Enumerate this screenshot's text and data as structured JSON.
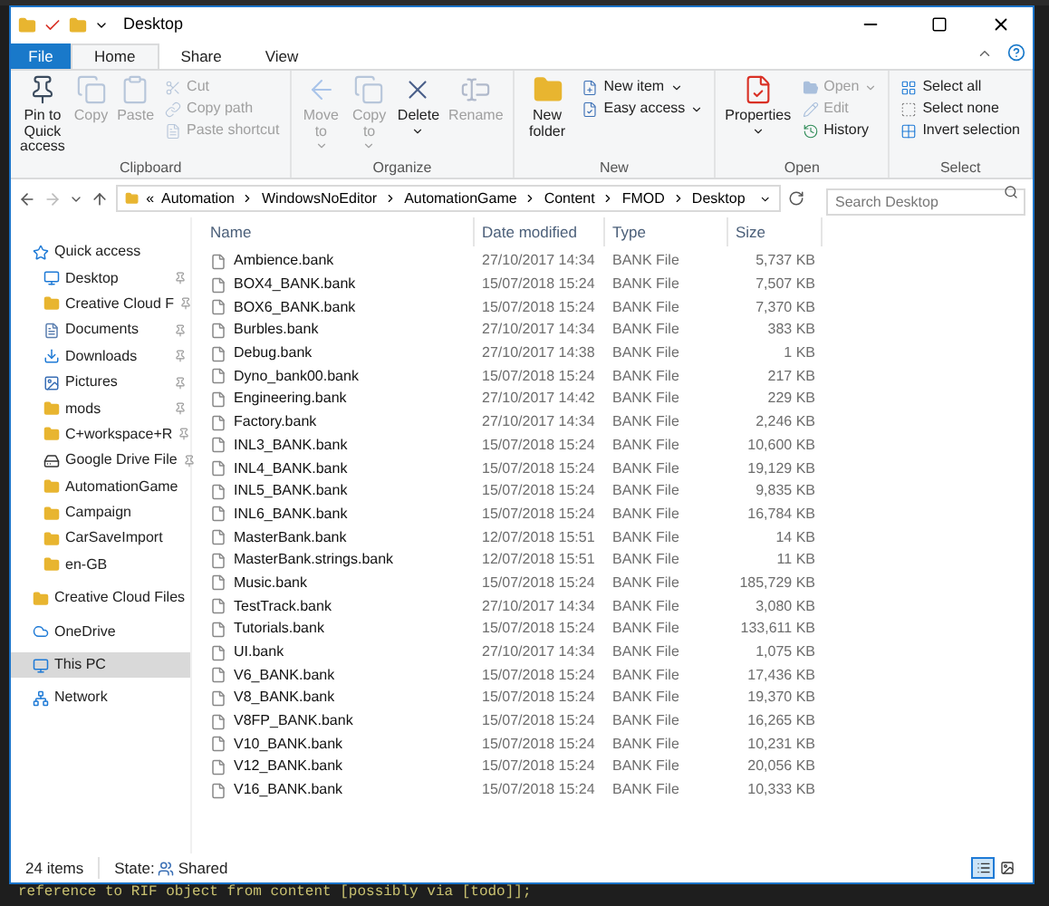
{
  "window": {
    "title": "Desktop"
  },
  "ribbon_tabs": [
    {
      "label": "File",
      "kind": "file",
      "selected": false
    },
    {
      "label": "Home",
      "kind": "tab",
      "selected": true
    },
    {
      "label": "Share",
      "kind": "tab",
      "selected": false
    },
    {
      "label": "View",
      "kind": "tab",
      "selected": false
    }
  ],
  "ribbon_groups": [
    {
      "label": "Clipboard",
      "buttons": [
        {
          "label": "Pin to Quick access",
          "kind": "large",
          "disabled": false
        },
        {
          "label": "Copy",
          "kind": "large",
          "disabled": true
        },
        {
          "label": "Paste",
          "kind": "large",
          "disabled": true
        },
        {
          "kind": "stack",
          "items": [
            {
              "label": "Cut",
              "disabled": true
            },
            {
              "label": "Copy path",
              "disabled": true
            },
            {
              "label": "Paste shortcut",
              "disabled": true
            }
          ]
        }
      ]
    },
    {
      "label": "Organize",
      "buttons": [
        {
          "label": "Move to",
          "kind": "large",
          "disabled": true,
          "dropdown": true
        },
        {
          "label": "Copy to",
          "kind": "large",
          "disabled": true,
          "dropdown": true
        },
        {
          "label": "Delete",
          "kind": "large",
          "disabled": false,
          "dropdown": true
        },
        {
          "label": "Rename",
          "kind": "large",
          "disabled": true
        }
      ]
    },
    {
      "label": "New",
      "buttons": [
        {
          "label": "New folder",
          "kind": "large",
          "disabled": false
        },
        {
          "kind": "stack",
          "items": [
            {
              "label": "New item",
              "disabled": false,
              "dropdown": true
            },
            {
              "label": "Easy access",
              "disabled": false,
              "dropdown": true
            }
          ]
        }
      ]
    },
    {
      "label": "Open",
      "buttons": [
        {
          "label": "Properties",
          "kind": "large",
          "disabled": false,
          "dropdown": true
        },
        {
          "kind": "stack",
          "items": [
            {
              "label": "Open",
              "disabled": true,
              "dropdown": true
            },
            {
              "label": "Edit",
              "disabled": true
            },
            {
              "label": "History",
              "disabled": false
            }
          ]
        }
      ]
    },
    {
      "label": "Select",
      "buttons": [
        {
          "kind": "stack",
          "items": [
            {
              "label": "Select all",
              "disabled": false
            },
            {
              "label": "Select none",
              "disabled": false
            },
            {
              "label": "Invert selection",
              "disabled": false
            }
          ]
        }
      ]
    }
  ],
  "address_bar": {
    "prefix": "«",
    "crumbs": [
      "Automation",
      "WindowsNoEditor",
      "AutomationGame",
      "Content",
      "FMOD",
      "Desktop"
    ]
  },
  "search": {
    "placeholder": "Search Desktop"
  },
  "sidebar": {
    "items": [
      {
        "label": "Quick access",
        "kind": "star",
        "selected": false,
        "children": [
          {
            "label": "Desktop",
            "kind": "desktop",
            "pinned": true,
            "selected": false
          },
          {
            "label": "Creative Cloud F",
            "kind": "cloud-folder",
            "pinned": true,
            "selected": false
          },
          {
            "label": "Documents",
            "kind": "documents",
            "pinned": true,
            "selected": false
          },
          {
            "label": "Downloads",
            "kind": "downloads",
            "pinned": true,
            "selected": false
          },
          {
            "label": "Pictures",
            "kind": "pictures",
            "pinned": true,
            "selected": false
          },
          {
            "label": "mods",
            "kind": "folder",
            "pinned": true,
            "selected": false
          },
          {
            "label": "C+workspace+R",
            "kind": "folder",
            "pinned": true,
            "selected": false
          },
          {
            "label": "Google Drive File",
            "kind": "drive",
            "pinned": true,
            "selected": false
          },
          {
            "label": "AutomationGame",
            "kind": "folder",
            "pinned": false,
            "selected": false
          },
          {
            "label": "Campaign",
            "kind": "folder",
            "pinned": false,
            "selected": false
          },
          {
            "label": "CarSaveImport",
            "kind": "folder",
            "pinned": false,
            "selected": false
          },
          {
            "label": "en-GB",
            "kind": "folder",
            "pinned": false,
            "selected": false
          }
        ]
      },
      {
        "label": "Creative Cloud Files",
        "kind": "cloud-folder",
        "selected": false
      },
      {
        "label": "OneDrive",
        "kind": "onedrive",
        "selected": false
      },
      {
        "label": "This PC",
        "kind": "pc",
        "selected": true
      },
      {
        "label": "Network",
        "kind": "network",
        "selected": false
      }
    ]
  },
  "table": {
    "columns": [
      "Name",
      "Date modified",
      "Type",
      "Size"
    ],
    "rows": [
      [
        "Ambience.bank",
        "27/10/2017 14:34",
        "BANK File",
        "5,737 KB"
      ],
      [
        "BOX4_BANK.bank",
        "15/07/2018 15:24",
        "BANK File",
        "7,507 KB"
      ],
      [
        "BOX6_BANK.bank",
        "15/07/2018 15:24",
        "BANK File",
        "7,370 KB"
      ],
      [
        "Burbles.bank",
        "27/10/2017 14:34",
        "BANK File",
        "383 KB"
      ],
      [
        "Debug.bank",
        "27/10/2017 14:38",
        "BANK File",
        "1 KB"
      ],
      [
        "Dyno_bank00.bank",
        "15/07/2018 15:24",
        "BANK File",
        "217 KB"
      ],
      [
        "Engineering.bank",
        "27/10/2017 14:42",
        "BANK File",
        "229 KB"
      ],
      [
        "Factory.bank",
        "27/10/2017 14:34",
        "BANK File",
        "2,246 KB"
      ],
      [
        "INL3_BANK.bank",
        "15/07/2018 15:24",
        "BANK File",
        "10,600 KB"
      ],
      [
        "INL4_BANK.bank",
        "15/07/2018 15:24",
        "BANK File",
        "19,129 KB"
      ],
      [
        "INL5_BANK.bank",
        "15/07/2018 15:24",
        "BANK File",
        "9,835 KB"
      ],
      [
        "INL6_BANK.bank",
        "15/07/2018 15:24",
        "BANK File",
        "16,784 KB"
      ],
      [
        "MasterBank.bank",
        "12/07/2018 15:51",
        "BANK File",
        "14 KB"
      ],
      [
        "MasterBank.strings.bank",
        "12/07/2018 15:51",
        "BANK File",
        "11 KB"
      ],
      [
        "Music.bank",
        "15/07/2018 15:24",
        "BANK File",
        "185,729 KB"
      ],
      [
        "TestTrack.bank",
        "27/10/2017 14:34",
        "BANK File",
        "3,080 KB"
      ],
      [
        "Tutorials.bank",
        "15/07/2018 15:24",
        "BANK File",
        "133,611 KB"
      ],
      [
        "UI.bank",
        "27/10/2017 14:34",
        "BANK File",
        "1,075 KB"
      ],
      [
        "V6_BANK.bank",
        "15/07/2018 15:24",
        "BANK File",
        "17,436 KB"
      ],
      [
        "V8_BANK.bank",
        "15/07/2018 15:24",
        "BANK File",
        "19,370 KB"
      ],
      [
        "V8FP_BANK.bank",
        "15/07/2018 15:24",
        "BANK File",
        "16,265 KB"
      ],
      [
        "V10_BANK.bank",
        "15/07/2018 15:24",
        "BANK File",
        "10,231 KB"
      ],
      [
        "V12_BANK.bank",
        "15/07/2018 15:24",
        "BANK File",
        "20,056 KB"
      ],
      [
        "V16_BANK.bank",
        "15/07/2018 15:24",
        "BANK File",
        "10,333 KB"
      ]
    ]
  },
  "status_bar": {
    "count": "24 items",
    "state_label": "State:",
    "state": "Shared",
    "views": [
      {
        "kind": "details",
        "selected": true
      },
      {
        "kind": "tiles",
        "selected": false
      }
    ]
  },
  "background_log": {
    "line": "reference to RIF object from content [possibly via [todo]];"
  }
}
